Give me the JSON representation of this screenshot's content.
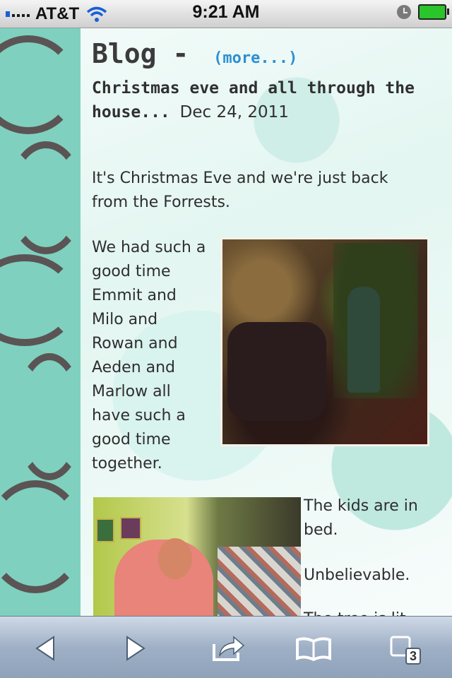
{
  "status_bar": {
    "carrier": "AT&T",
    "time": "9:21 AM"
  },
  "blog": {
    "heading": "Blog -",
    "more_link": "(more...)",
    "post_title": "Christmas eve and all through the house...",
    "post_date": "Dec 24, 2011",
    "paragraph_1": "It's Christmas Eve and we're just back from the Forrests.",
    "paragraph_2": "We had such a good time Emmit and Milo and Rowan and Aeden and Marlow all have such a good time together.",
    "paragraph_3": "The kids are in bed.",
    "paragraph_4": "Unbelievable.",
    "paragraph_5": "The tree is lit"
  },
  "toolbar": {
    "tabs_count": "3"
  },
  "colors": {
    "sidebar": "#7fd0bf",
    "link": "#2d8fd3",
    "text": "#2e2e2e"
  }
}
